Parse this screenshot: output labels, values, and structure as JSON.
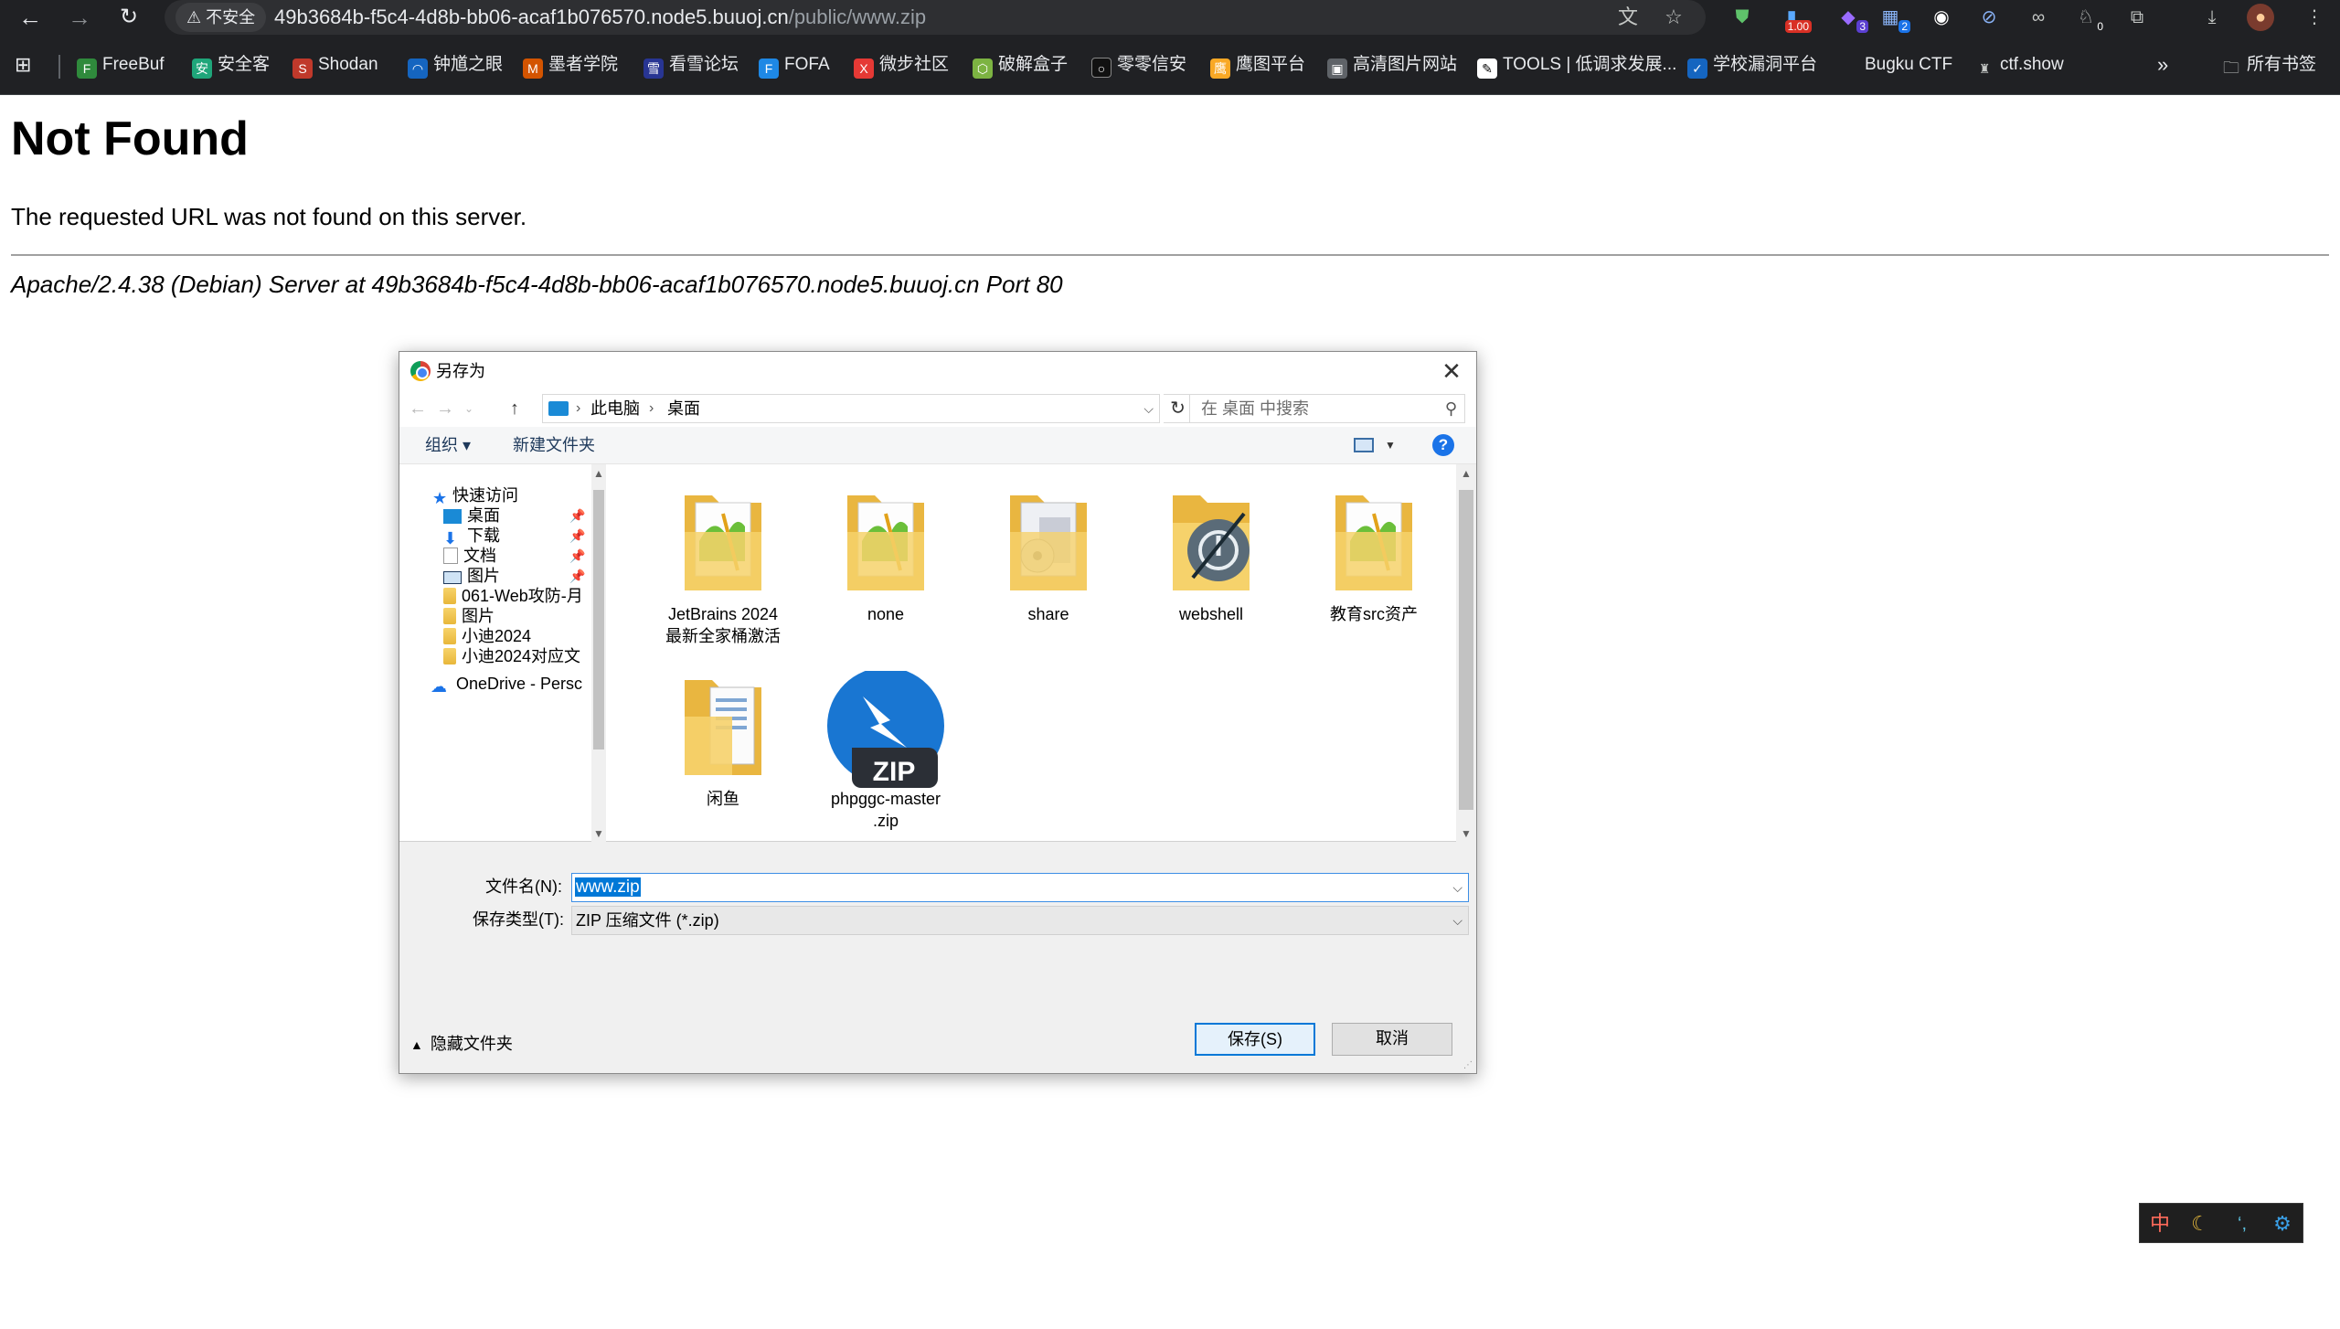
{
  "browser": {
    "security_chip": "⚠ 不安全",
    "url_host": "49b3684b-f5c4-4d8b-bb06-acaf1b076570.node5.buuoj.cn",
    "url_path": "/public/www.zip",
    "extension_badges": {
      "wallet": "1.00",
      "counter": "3",
      "multi": "2",
      "small": "0"
    }
  },
  "bookmarks": [
    "FreeBuf",
    "安全客",
    "Shodan",
    "钟馗之眼",
    "墨者学院",
    "看雪论坛",
    "FOFA",
    "微步社区",
    "破解盒子",
    "零零信安",
    "鹰图平台",
    "高清图片网站",
    "TOOLS | 低调求发展...",
    "学校漏洞平台",
    "Bugku CTF",
    "ctf.show"
  ],
  "bookmarks_overflow": "»",
  "all_bookmarks": "所有书签",
  "page": {
    "heading": "Not Found",
    "message": "The requested URL was not found on this server.",
    "address": "Apache/2.4.38 (Debian) Server at 49b3684b-f5c4-4d8b-bb06-acaf1b076570.node5.buuoj.cn Port 80"
  },
  "dialog": {
    "title": "另存为",
    "breadcrumb": [
      "此电脑",
      "桌面"
    ],
    "search_placeholder": "在 桌面 中搜索",
    "organize": "组织 ▾",
    "new_folder": "新建文件夹",
    "help": "?",
    "nav": {
      "quick_access": "快速访问",
      "items": [
        "桌面",
        "下载",
        "文档",
        "图片",
        "061-Web攻防-月",
        "图片",
        "小迪2024",
        "小迪2024对应文"
      ],
      "onedrive": "OneDrive - Persc"
    },
    "files": [
      {
        "name": "JetBrains  2024\n最新全家桶激活",
        "icon": "folder-green-icon"
      },
      {
        "name": "none",
        "icon": "folder-green-icon"
      },
      {
        "name": "share",
        "icon": "folder-share-icon"
      },
      {
        "name": "webshell",
        "icon": "folder-webshell-icon"
      },
      {
        "name": "教育src资产",
        "icon": "folder-green-icon"
      },
      {
        "name": "闲鱼",
        "icon": "folder-doc-icon"
      },
      {
        "name": "phpggc-master\n.zip",
        "icon": "zip-file-icon"
      }
    ],
    "filename_label": "文件名(N):",
    "filename_value": "www.zip",
    "filetype_label": "保存类型(T):",
    "filetype_value": "ZIP 压缩文件 (*.zip)",
    "hide_folders": "隐藏文件夹",
    "save_button": "保存(S)",
    "cancel_button": "取消"
  },
  "ime": {
    "mode": "中",
    "moon": "☾",
    "punct": "‘,",
    "settings": "⚙"
  },
  "colors": {
    "chrome_bg": "#202124",
    "accent": "#0078d7",
    "dialog_bg": "#f0f0f0"
  }
}
